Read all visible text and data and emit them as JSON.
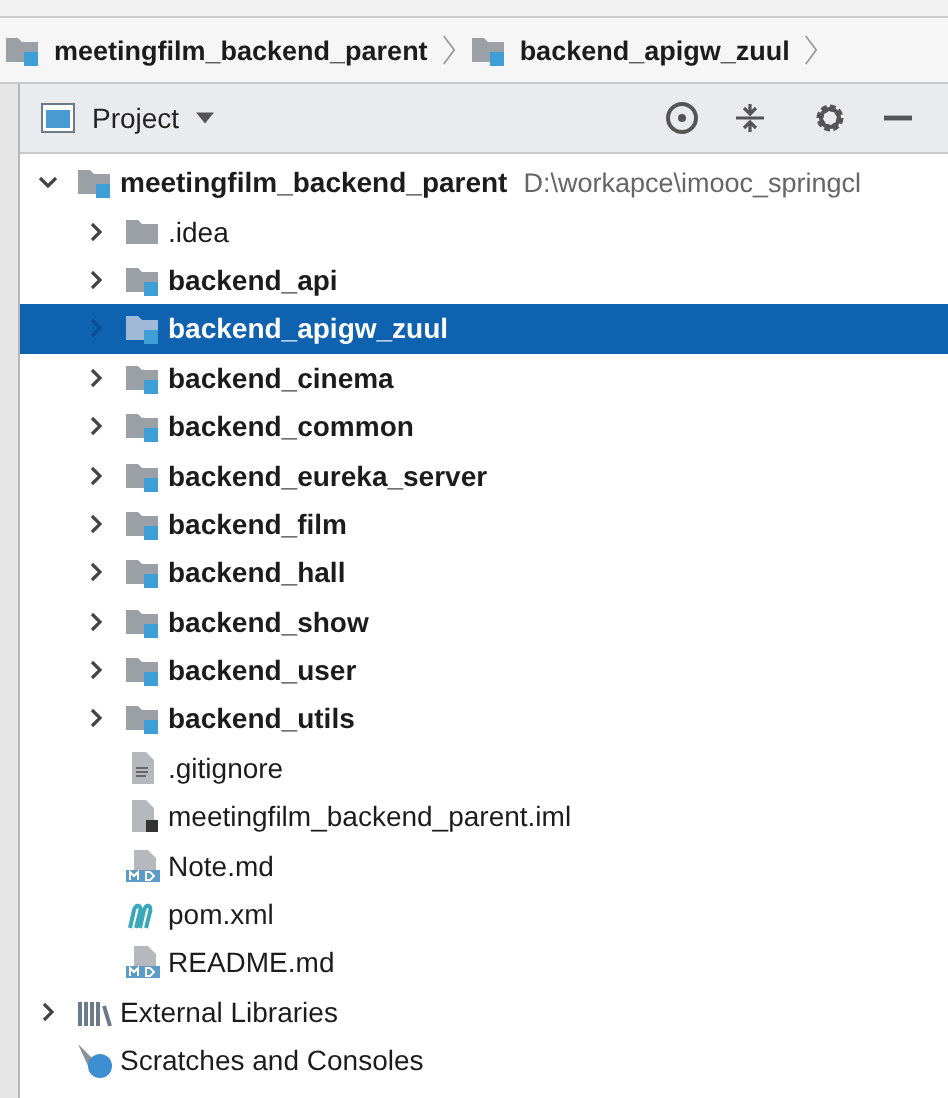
{
  "breadcrumbs": [
    {
      "label": "meetingfilm_backend_parent",
      "kind": "module"
    },
    {
      "label": "backend_apigw_zuul",
      "kind": "module"
    }
  ],
  "panel": {
    "title": "Project"
  },
  "tree": [
    {
      "label": "meetingfilm_backend_parent",
      "path": "D:\\workapce\\imooc_springcl",
      "kind": "module",
      "expanded": true,
      "selected": false,
      "children": [
        {
          "label": ".idea",
          "kind": "folder",
          "expanded": false,
          "selected": false
        },
        {
          "label": "backend_api",
          "kind": "module",
          "expanded": false,
          "selected": false
        },
        {
          "label": "backend_apigw_zuul",
          "kind": "module",
          "expanded": false,
          "selected": true
        },
        {
          "label": "backend_cinema",
          "kind": "module",
          "expanded": false,
          "selected": false
        },
        {
          "label": "backend_common",
          "kind": "module",
          "expanded": false,
          "selected": false
        },
        {
          "label": "backend_eureka_server",
          "kind": "module",
          "expanded": false,
          "selected": false
        },
        {
          "label": "backend_film",
          "kind": "module",
          "expanded": false,
          "selected": false
        },
        {
          "label": "backend_hall",
          "kind": "module",
          "expanded": false,
          "selected": false
        },
        {
          "label": "backend_show",
          "kind": "module",
          "expanded": false,
          "selected": false
        },
        {
          "label": "backend_user",
          "kind": "module",
          "expanded": false,
          "selected": false
        },
        {
          "label": "backend_utils",
          "kind": "module",
          "expanded": false,
          "selected": false
        },
        {
          "label": ".gitignore",
          "kind": "text",
          "selected": false
        },
        {
          "label": "meetingfilm_backend_parent.iml",
          "kind": "iml",
          "selected": false
        },
        {
          "label": "Note.md",
          "kind": "md",
          "selected": false
        },
        {
          "label": "pom.xml",
          "kind": "maven",
          "selected": false
        },
        {
          "label": "README.md",
          "kind": "md",
          "selected": false
        }
      ]
    },
    {
      "label": "External Libraries",
      "kind": "libraries",
      "expanded": false,
      "selected": false
    },
    {
      "label": "Scratches and Consoles",
      "kind": "scratches",
      "selected": false
    }
  ]
}
